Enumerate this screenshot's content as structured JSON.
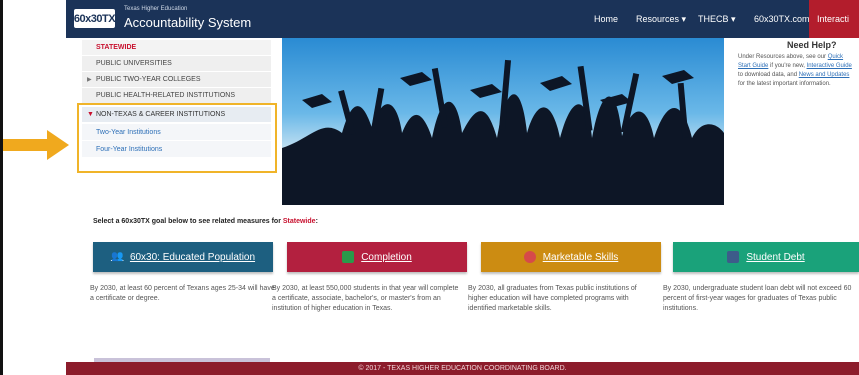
{
  "header": {
    "logo": "60x30TX",
    "subtitle": "Texas Higher Education",
    "title": "Accountability System",
    "nav": {
      "home": "Home",
      "resources": "Resources ▾",
      "thecb": "THECB ▾",
      "site": "60x30TX.com",
      "interact": "Interacti"
    }
  },
  "sidebar": {
    "items": [
      "STATEWIDE",
      "PUBLIC UNIVERSITIES",
      "PUBLIC TWO-YEAR COLLEGES",
      "PUBLIC HEALTH-RELATED INSTITUTIONS"
    ],
    "expanded": {
      "label": "NON-TEXAS & CAREER INSTITUTIONS",
      "children": [
        "Two-Year Institutions",
        "Four-Year Institutions"
      ]
    }
  },
  "help": {
    "title": "Need Help?",
    "p1": "Under Resources above, see our ",
    "link1": "Quick Start Guide",
    "p2": " if you're new, ",
    "link2": "Interactive Guide",
    "p3": " to download data, and ",
    "link3": "News and Updates",
    "p4": " for the latest important information."
  },
  "goals": {
    "prompt_text": "Select a 60x30TX goal below to see related measures for ",
    "prompt_highlight": "Statewide",
    "prompt_end": ":",
    "items": [
      {
        "label": "60x30: Educated Population",
        "color": "#1d5f80",
        "desc": "By 2030, at least 60 percent of Texans ages 25-34 will have a certificate or degree."
      },
      {
        "label": "Completion",
        "color": "#b3203f",
        "desc": "By 2030, at least 550,000 students in that year will complete a certificate, associate, bachelor's, or master's from an institution of higher education in Texas."
      },
      {
        "label": "Marketable Skills",
        "color": "#cc8c12",
        "desc": "By 2030, all graduates from Texas public institutions of higher education will have completed programs with identified marketable skills."
      },
      {
        "label": "Student Debt",
        "color": "#1aa27a",
        "desc": "By 2030, undergraduate student loan debt will not exceed 60 percent of first-year wages for graduates of Texas public institutions."
      }
    ]
  },
  "footer": "© 2017 - TEXAS HIGHER EDUCATION COORDINATING BOARD."
}
